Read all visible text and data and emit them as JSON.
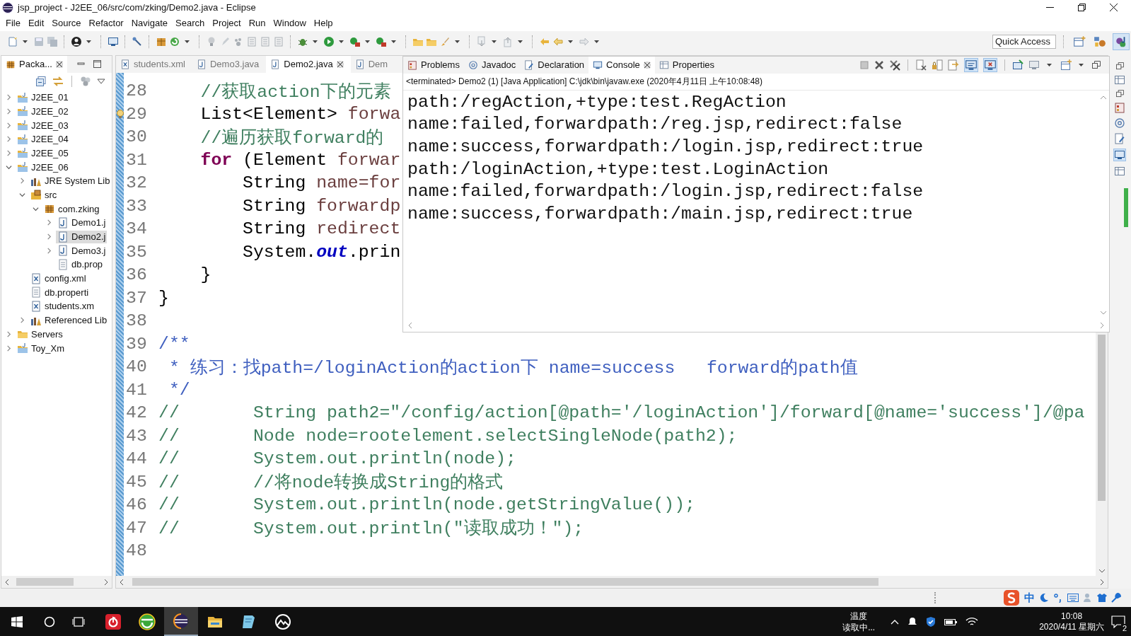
{
  "window": {
    "title": "jsp_project - J2EE_06/src/com/zking/Demo2.java - Eclipse"
  },
  "menu": [
    "File",
    "Edit",
    "Source",
    "Refactor",
    "Navigate",
    "Search",
    "Project",
    "Run",
    "Window",
    "Help"
  ],
  "quick_access": {
    "placeholder": "Quick Access"
  },
  "perspectives": [
    {
      "kind": "open",
      "selected": false
    },
    {
      "kind": "team",
      "selected": false
    },
    {
      "kind": "java",
      "selected": true
    }
  ],
  "package_explorer": {
    "tab": {
      "label": "Packa...",
      "selected": true
    },
    "tree": [
      {
        "label": "J2EE_01",
        "kind": "project",
        "expanded": false,
        "selected": false
      },
      {
        "label": "J2EE_02",
        "kind": "project",
        "expanded": false,
        "selected": false
      },
      {
        "label": "J2EE_03",
        "kind": "project",
        "expanded": false,
        "selected": false
      },
      {
        "label": "J2EE_04",
        "kind": "project",
        "expanded": false,
        "selected": false
      },
      {
        "label": "J2EE_05",
        "kind": "project",
        "expanded": false,
        "selected": false
      },
      {
        "label": "J2EE_06",
        "kind": "project",
        "expanded": true,
        "selected": false,
        "children": [
          {
            "label": "JRE System Lib",
            "kind": "library",
            "expanded": false,
            "selected": false
          },
          {
            "label": "src",
            "kind": "source",
            "expanded": true,
            "selected": false,
            "children": [
              {
                "label": "com.zking",
                "kind": "package",
                "expanded": true,
                "selected": false,
                "children": [
                  {
                    "label": "Demo1.j",
                    "kind": "java",
                    "expanded": false,
                    "selected": false
                  },
                  {
                    "label": "Demo2.j",
                    "kind": "java",
                    "expanded": false,
                    "selected": true
                  },
                  {
                    "label": "Demo3.j",
                    "kind": "java",
                    "expanded": false,
                    "selected": false
                  },
                  {
                    "label": "db.prop",
                    "kind": "text",
                    "selected": false
                  }
                ]
              }
            ]
          },
          {
            "label": "config.xml",
            "kind": "xml",
            "selected": false
          },
          {
            "label": "db.properti",
            "kind": "text",
            "selected": false
          },
          {
            "label": "students.xm",
            "kind": "xml",
            "selected": false
          },
          {
            "label": "Referenced Lib",
            "kind": "library",
            "expanded": false,
            "selected": false
          }
        ]
      },
      {
        "label": "Servers",
        "kind": "folder",
        "expanded": false,
        "selected": false
      },
      {
        "label": "Toy_Xm",
        "kind": "project",
        "expanded": false,
        "selected": false
      }
    ]
  },
  "editor": {
    "tabs": [
      {
        "label": "students.xml",
        "kind": "xml",
        "selected": false
      },
      {
        "label": "Demo3.java",
        "kind": "java",
        "selected": false
      },
      {
        "label": "Demo2.java",
        "kind": "java",
        "selected": true
      },
      {
        "label": "Dem",
        "kind": "java",
        "selected": false
      }
    ],
    "lines": [
      {
        "number": "28",
        "warning": false,
        "segments": [
          {
            "text": "    //获取action下的元素",
            "kind": "comment"
          }
        ]
      },
      {
        "number": "29",
        "warning": true,
        "segments": [
          {
            "text": "    List<Element> ",
            "kind": "plain"
          },
          {
            "text": "forwa",
            "kind": "variable"
          }
        ]
      },
      {
        "number": "30",
        "warning": false,
        "segments": [
          {
            "text": "    //遍历获取forward的",
            "kind": "comment"
          }
        ]
      },
      {
        "number": "31",
        "warning": false,
        "segments": [
          {
            "text": "    for",
            "kind": "keyword"
          },
          {
            "text": " (Element ",
            "kind": "plain"
          },
          {
            "text": "forwar",
            "kind": "variable"
          }
        ]
      },
      {
        "number": "32",
        "warning": false,
        "segments": [
          {
            "text": "        String ",
            "kind": "plain"
          },
          {
            "text": "name=for",
            "kind": "variable"
          }
        ]
      },
      {
        "number": "33",
        "warning": false,
        "segments": [
          {
            "text": "        String ",
            "kind": "plain"
          },
          {
            "text": "forwardp",
            "kind": "variable"
          }
        ]
      },
      {
        "number": "34",
        "warning": false,
        "segments": [
          {
            "text": "        String ",
            "kind": "plain"
          },
          {
            "text": "redirect",
            "kind": "variable"
          }
        ]
      },
      {
        "number": "35",
        "warning": false,
        "segments": [
          {
            "text": "        System.",
            "kind": "plain"
          },
          {
            "text": "out",
            "kind": "field"
          },
          {
            "text": ".prin",
            "kind": "plain"
          }
        ]
      },
      {
        "number": "36",
        "warning": false,
        "segments": [
          {
            "text": "    }",
            "kind": "plain"
          }
        ]
      },
      {
        "number": "37",
        "warning": false,
        "segments": [
          {
            "text": "}",
            "kind": "plain"
          }
        ]
      },
      {
        "number": "38",
        "warning": false
      },
      {
        "number": "39",
        "warning": false,
        "segments": [
          {
            "text": "/**",
            "kind": "javadoc"
          }
        ]
      },
      {
        "number": "40",
        "warning": false,
        "segments": [
          {
            "text": " * 练习：找path=/loginAction的action下 name=success   forward的path值",
            "kind": "javadoc"
          }
        ]
      },
      {
        "number": "41",
        "warning": false,
        "segments": [
          {
            "text": " */",
            "kind": "javadoc"
          }
        ]
      },
      {
        "number": "42",
        "warning": false,
        "segments": [
          {
            "text": "//       String path2=\"/config/action[@path='/loginAction']/forward[@name='success']/@pa",
            "kind": "comment"
          }
        ]
      },
      {
        "number": "43",
        "warning": false,
        "segments": [
          {
            "text": "//       Node node=rootelement.selectSingleNode(path2);",
            "kind": "comment"
          }
        ]
      },
      {
        "number": "44",
        "warning": false,
        "segments": [
          {
            "text": "//       System.out.println(node);",
            "kind": "comment"
          }
        ]
      },
      {
        "number": "45",
        "warning": false,
        "segments": [
          {
            "text": "//       //将node转换成String的格式",
            "kind": "comment"
          }
        ]
      },
      {
        "number": "46",
        "warning": false,
        "segments": [
          {
            "text": "//       System.out.println(node.getStringValue());",
            "kind": "comment"
          }
        ]
      },
      {
        "number": "47",
        "warning": false,
        "segments": [
          {
            "text": "//       System.out.println(\"读取成功！\");",
            "kind": "comment"
          }
        ]
      },
      {
        "number": "48",
        "warning": false
      }
    ]
  },
  "console_view": {
    "tabs": [
      {
        "label": "Problems",
        "kind": "problems",
        "selected": false
      },
      {
        "label": "Javadoc",
        "kind": "javadoc",
        "selected": false
      },
      {
        "label": "Declaration",
        "kind": "declaration",
        "selected": false
      },
      {
        "label": "Console",
        "kind": "console",
        "selected": true
      },
      {
        "label": "Properties",
        "kind": "properties",
        "selected": false
      }
    ],
    "status": "<terminated> Demo2 (1) [Java Application] C:\\jdk\\bin\\javaw.exe (2020年4月11日 上午10:08:48)",
    "output": [
      "path:/regAction,+type:test.RegAction",
      "name:failed,forwardpath:/reg.jsp,redirect:false",
      "name:success,forwardpath:/login.jsp,redirect:true",
      "path:/loginAction,+type:test.LoginAction",
      "name:failed,forwardpath:/login.jsp,redirect:false",
      "name:success,forwardpath:/main.jsp,redirect:true"
    ]
  },
  "status_bar": {
    "ime_mode": "中"
  },
  "taskbar": {
    "apps": [
      {
        "kind": "music",
        "selected": false
      },
      {
        "kind": "browser",
        "selected": false
      },
      {
        "kind": "eclipse",
        "selected": true
      },
      {
        "kind": "folder",
        "selected": false
      },
      {
        "kind": "notes",
        "selected": false
      },
      {
        "kind": "mountain",
        "selected": false
      }
    ],
    "weather": [
      "温度",
      "读取中..."
    ],
    "time": "10:08",
    "date": "2020/4/11 星期六",
    "notifications": "2"
  }
}
